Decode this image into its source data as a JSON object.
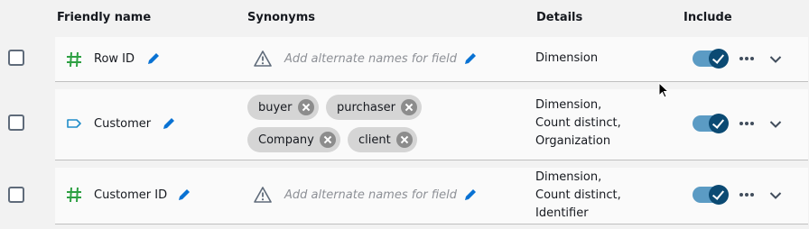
{
  "header": {
    "friendly_name": "Friendly name",
    "synonyms": "Synonyms",
    "details": "Details",
    "include": "Include"
  },
  "rows": [
    {
      "name": "Row ID",
      "type_icon": "hash-icon",
      "synonyms_placeholder": "Add alternate names for field",
      "details": [
        "Dimension"
      ],
      "include": true
    },
    {
      "name": "Customer",
      "type_icon": "tag-icon",
      "synonyms": [
        "buyer",
        "purchaser",
        "Company",
        "client"
      ],
      "details": [
        "Dimension,",
        "Count distinct,",
        "Organization"
      ],
      "include": true
    },
    {
      "name": "Customer ID",
      "type_icon": "hash-icon",
      "synonyms_placeholder": "Add alternate names for field",
      "details": [
        "Dimension,",
        "Count distinct,",
        "Identifier"
      ],
      "include": true
    }
  ],
  "colors": {
    "accent": "#0b4a73",
    "toggle_track": "#5b9bc4",
    "hash_icon": "#2ea043",
    "tag_icon": "#1f8cc9",
    "pencil": "#0972d3"
  }
}
